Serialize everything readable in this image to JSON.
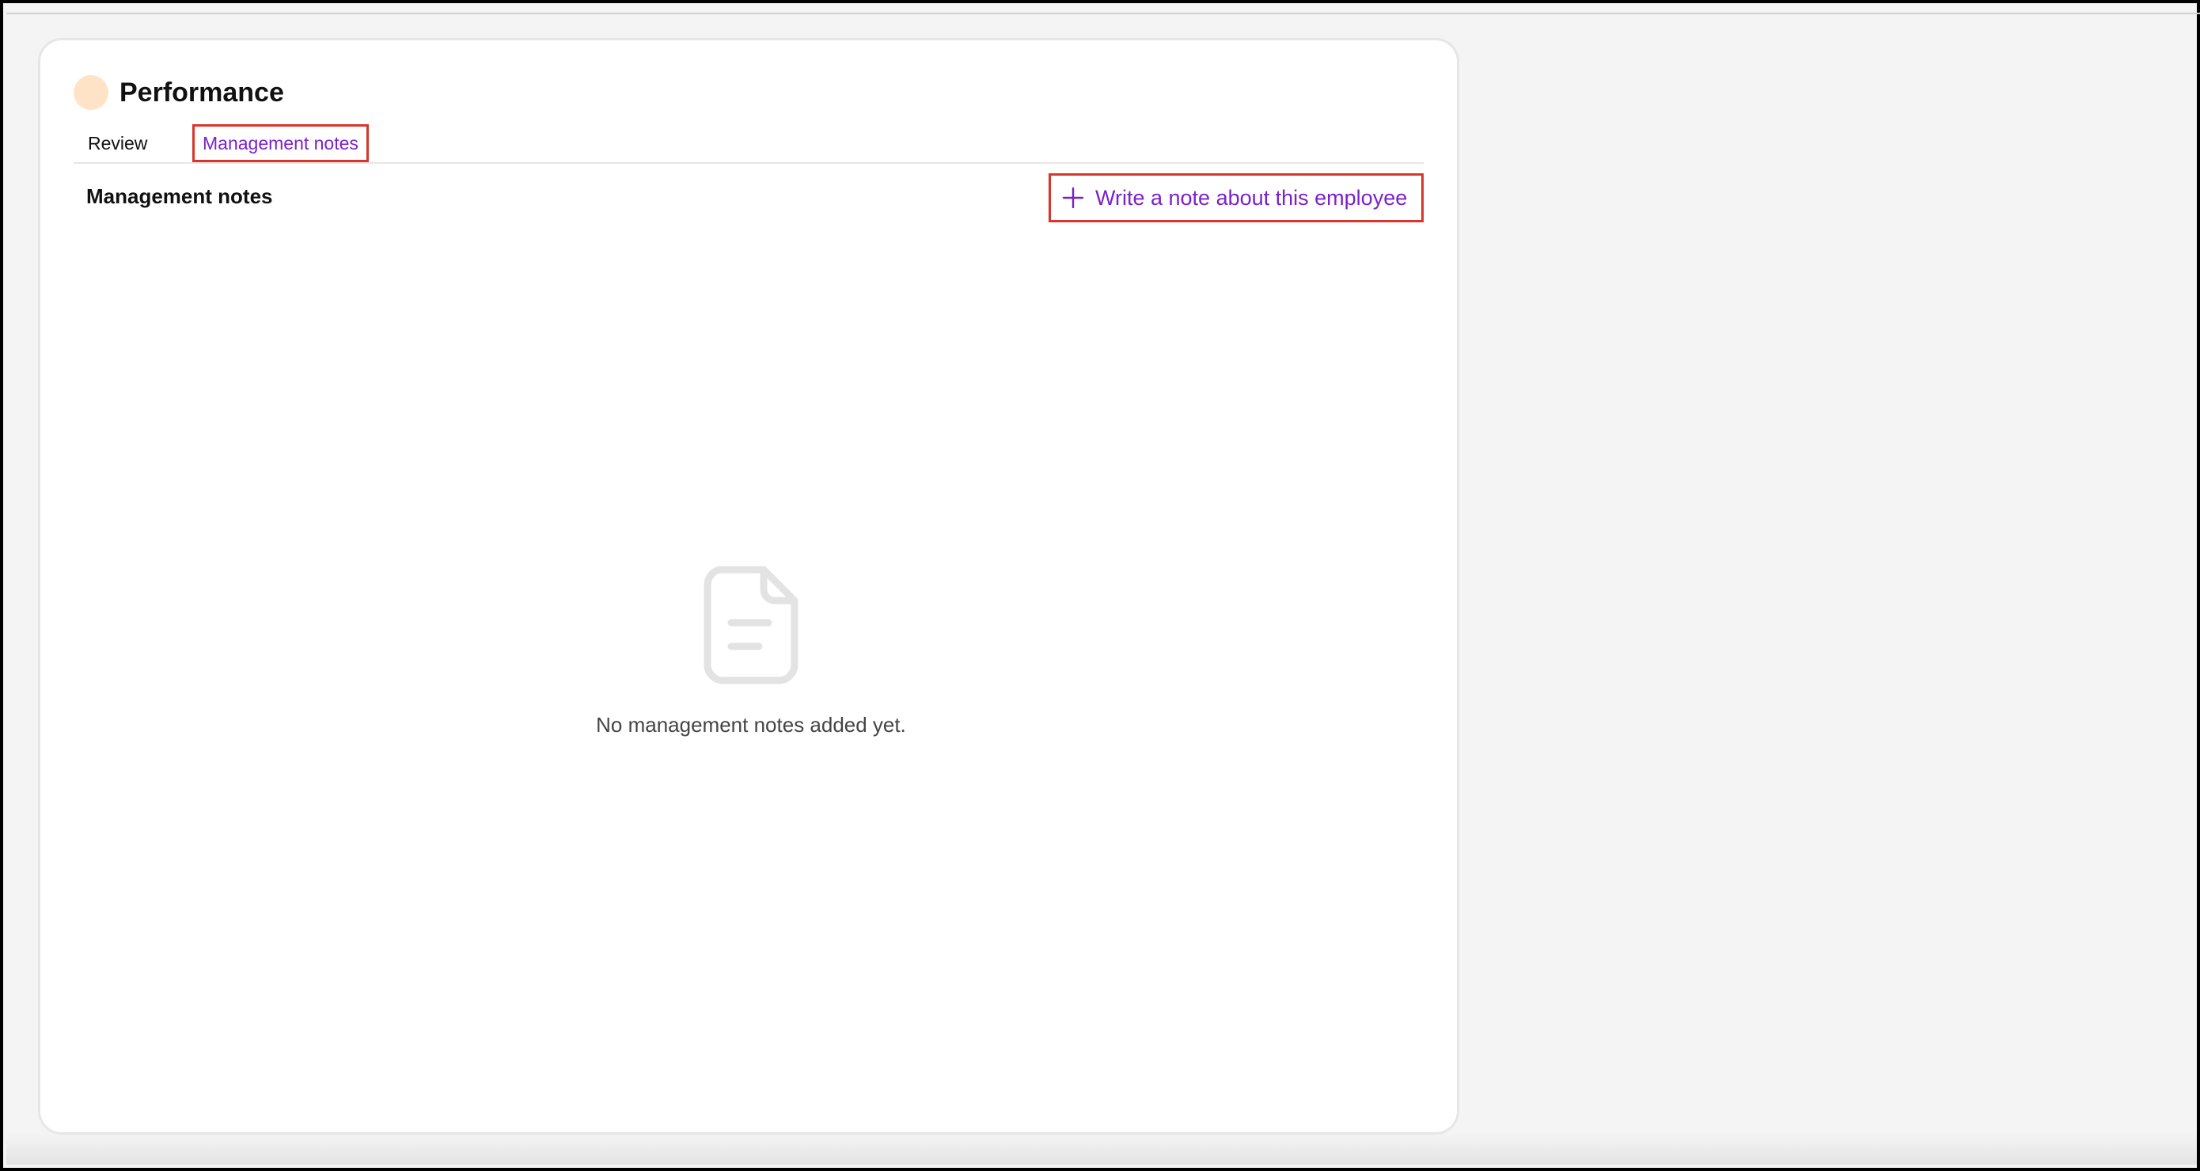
{
  "card": {
    "title": "Performance",
    "avatar_color": "#ffe3c6"
  },
  "tabs": [
    {
      "label": "Review",
      "active": false
    },
    {
      "label": "Management notes",
      "active": true
    }
  ],
  "section": {
    "title": "Management notes",
    "write_button_label": "Write a note about this employee"
  },
  "empty_state": {
    "icon": "document-icon",
    "message": "No management notes added yet."
  },
  "colors": {
    "accent": "#7a22c9",
    "highlight_border": "#d8362a",
    "background": "#f4f4f4"
  }
}
